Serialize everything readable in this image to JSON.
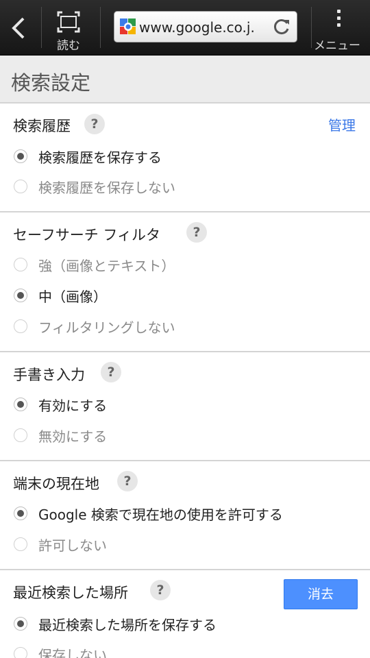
{
  "browser": {
    "read_label": "読む",
    "url": "www.google.co.j.",
    "menu_label": "メニュー"
  },
  "page": {
    "title": "検索設定"
  },
  "sections": {
    "history": {
      "title": "検索履歴",
      "help": "?",
      "manage_link": "管理",
      "options": [
        "検索履歴を保存する",
        "検索履歴を保存しない"
      ],
      "selected": 0
    },
    "safesearch": {
      "title": "セーフサーチ フィルタ",
      "help": "?",
      "options": [
        "強（画像とテキスト）",
        "中（画像）",
        "フィルタリングしない"
      ],
      "selected": 1
    },
    "handwriting": {
      "title": "手書き入力",
      "help": "?",
      "options": [
        "有効にする",
        "無効にする"
      ],
      "selected": 0
    },
    "location": {
      "title": "端末の現在地",
      "help": "?",
      "options": [
        "Google 検索で現在地の使用を許可する",
        "許可しない"
      ],
      "selected": 0
    },
    "recent_places": {
      "title": "最近検索した場所",
      "help": "?",
      "clear_button": "消去",
      "options": [
        "最近検索した場所を保存する",
        "保存しない"
      ],
      "selected": 0
    }
  },
  "colors": {
    "link": "#3b78e7",
    "button": "#4d90fe",
    "topbar": "#1e1e1e"
  }
}
